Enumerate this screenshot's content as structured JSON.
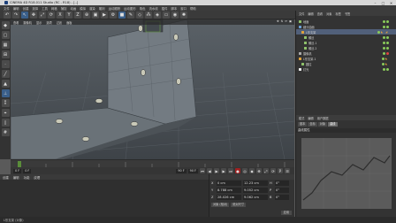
{
  "window": {
    "title": "CINEMA 4D R18.011 Studio (RC - R18) - [..]",
    "controls": [
      "–",
      "□",
      "✕"
    ]
  },
  "menu": [
    "文件",
    "编辑",
    "创建",
    "选择",
    "工具",
    "网格",
    "捕捉",
    "动画",
    "模拟",
    "渲染",
    "雕刻",
    "运动跟踪",
    "运动图形",
    "角色",
    "流水线",
    "插件",
    "脚本",
    "窗口",
    "帮助"
  ],
  "toolbar_icons": [
    "undo-icon",
    "redo-icon",
    "select-icon",
    "move-icon",
    "scale-icon",
    "rotate-icon",
    "axis-x-icon",
    "axis-y-icon",
    "axis-z-icon",
    "coord-icon",
    "render-region-icon",
    "render-view-icon",
    "render-settings-icon",
    "cube-icon",
    "pen-icon",
    "subdivision-icon",
    "array-icon",
    "deformer-icon",
    "floor-icon",
    "camera-icon",
    "light-icon"
  ],
  "viewport": {
    "menu": [
      "查看",
      "摄像机",
      "显示",
      "选项",
      "过滤",
      "面板"
    ],
    "label": "透视视图"
  },
  "objects_panel": {
    "menu": [
      "文件",
      "编辑",
      "查看",
      "对象",
      "标签",
      "书签"
    ],
    "items": [
      {
        "label": "地面",
        "selected": false
      },
      {
        "label": "细分曲面",
        "selected": false
      },
      {
        "label": "L形支架",
        "selected": true
      },
      {
        "label": "螺丝",
        "selected": false
      },
      {
        "label": "螺丝.1",
        "selected": false
      },
      {
        "label": "螺丝.2",
        "selected": false
      },
      {
        "label": "摄像机",
        "selected": false
      },
      {
        "label": "L形支架.1",
        "selected": false
      },
      {
        "label": "圆柱",
        "selected": false
      },
      {
        "label": "灯光",
        "selected": false
      }
    ]
  },
  "attributes_panel": {
    "menu": [
      "模式",
      "编辑",
      "用户数据"
    ],
    "tabs": [
      "基本",
      "坐标",
      "对象",
      "曲线"
    ],
    "active_tab": "曲线",
    "section": "曲线属性"
  },
  "playbar": {
    "start": "0 F",
    "current": "0 F",
    "end": "90 F",
    "fps": "90 F"
  },
  "material_panel": {
    "menu": [
      "创建",
      "编辑",
      "功能",
      "纹理"
    ]
  },
  "coordinates": {
    "labels": [
      "X",
      "Y",
      "Z"
    ],
    "pos": [
      "0 cm",
      "8.788 cm",
      "28.026 cm"
    ],
    "size": [
      "12.23 cm",
      "9.052 cm",
      "9.062 cm"
    ],
    "rot_labels": [
      "H",
      "P",
      "B"
    ],
    "rot": [
      "0°",
      "0°",
      "0°"
    ],
    "mode_obj": "对象 (相对)",
    "mode_size": "绝对尺寸",
    "apply": "应用"
  },
  "status": "L形支架 (对象)",
  "colors": {
    "accent": "#51607a",
    "record": "#a02020"
  }
}
